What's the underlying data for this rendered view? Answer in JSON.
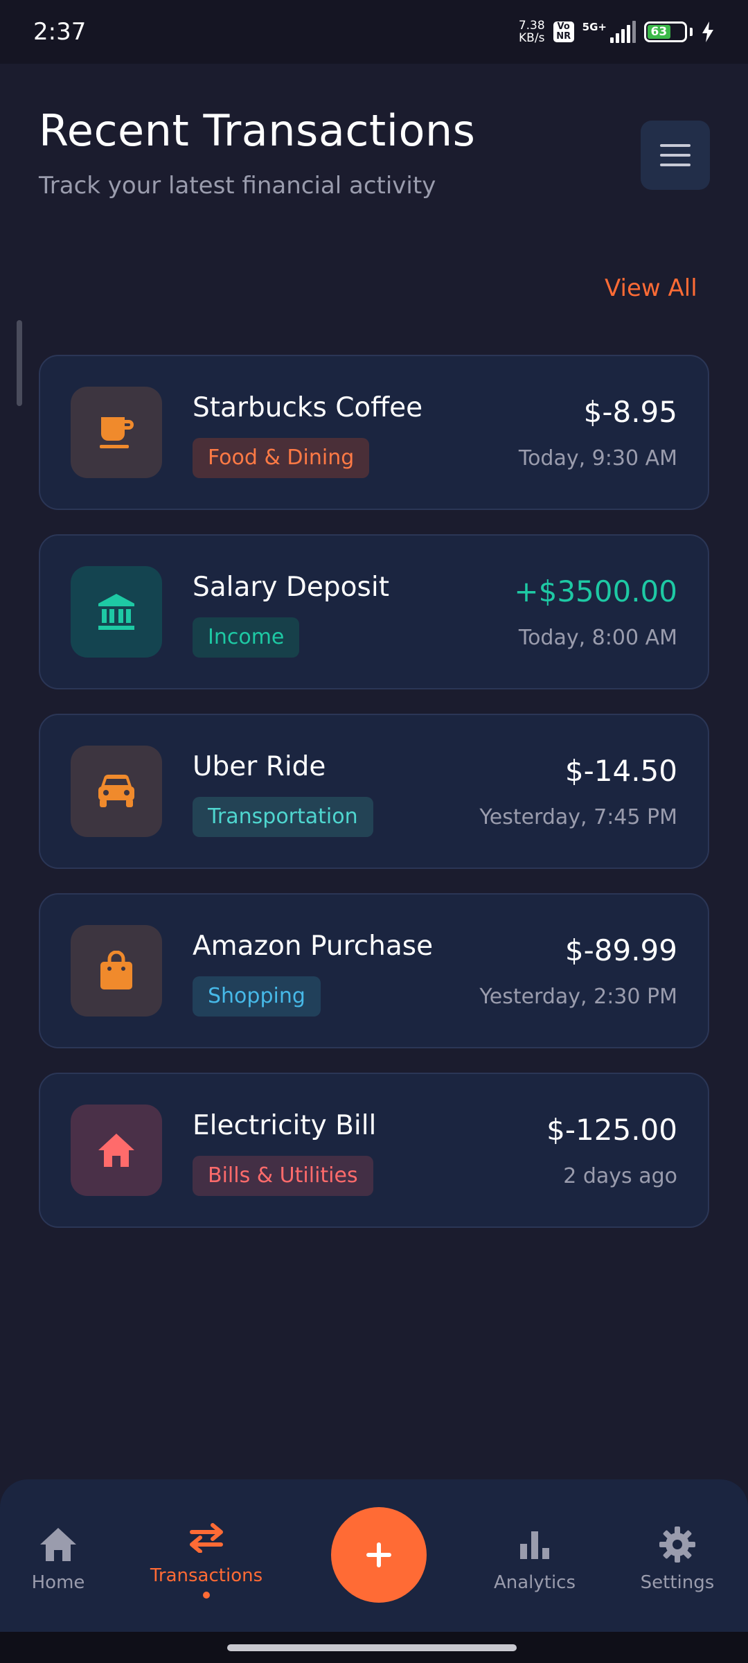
{
  "status_bar": {
    "time": "2:37",
    "net_speed_value": "7.38",
    "net_speed_unit": "KB/s",
    "volte_top": "Vo",
    "volte_bottom": "NR",
    "network": "5G+",
    "battery": "63"
  },
  "header": {
    "title": "Recent Transactions",
    "subtitle": "Track your latest financial activity",
    "menu_icon": "hamburger-menu-icon"
  },
  "view_all_label": "View All",
  "colors": {
    "accent": "#ff6b35",
    "income": "#1ec9a4",
    "background": "#1b1c2e",
    "card": "#1b2540"
  },
  "transactions": [
    {
      "name": "Starbucks Coffee",
      "category": "Food & Dining",
      "amount": "$-8.95",
      "time": "Today, 9:30 AM",
      "icon": "coffee-cup-icon",
      "icon_bg": "#3d3540",
      "icon_color": "#f08a2c",
      "badge_bg": "#4a2f38",
      "badge_color": "#ff7a45",
      "type": "expense"
    },
    {
      "name": "Salary Deposit",
      "category": "Income",
      "amount": "+$3500.00",
      "time": "Today, 8:00 AM",
      "icon": "bank-icon",
      "icon_bg": "#144450",
      "icon_color": "#1ec9a4",
      "badge_bg": "#17404a",
      "badge_color": "#1ec9a4",
      "type": "income"
    },
    {
      "name": "Uber Ride",
      "category": "Transportation",
      "amount": "$-14.50",
      "time": "Yesterday, 7:45 PM",
      "icon": "car-icon",
      "icon_bg": "#3d3540",
      "icon_color": "#f08a2c",
      "badge_bg": "#234355",
      "badge_color": "#4fd6cf",
      "type": "expense"
    },
    {
      "name": "Amazon Purchase",
      "category": "Shopping",
      "amount": "$-89.99",
      "time": "Yesterday, 2:30 PM",
      "icon": "shopping-bag-icon",
      "icon_bg": "#3d3540",
      "icon_color": "#f08a2c",
      "badge_bg": "#21405a",
      "badge_color": "#47b9e8",
      "type": "expense"
    },
    {
      "name": "Electricity Bill",
      "category": "Bills & Utilities",
      "amount": "$-125.00",
      "time": "2 days ago",
      "icon": "house-icon",
      "icon_bg": "#4a3048",
      "icon_color": "#ff6b6b",
      "badge_bg": "#432f45",
      "badge_color": "#ff6b6b",
      "type": "expense"
    }
  ],
  "nav": {
    "home": "Home",
    "transactions": "Transactions",
    "add": "+",
    "analytics": "Analytics",
    "settings": "Settings",
    "active": "transactions"
  }
}
